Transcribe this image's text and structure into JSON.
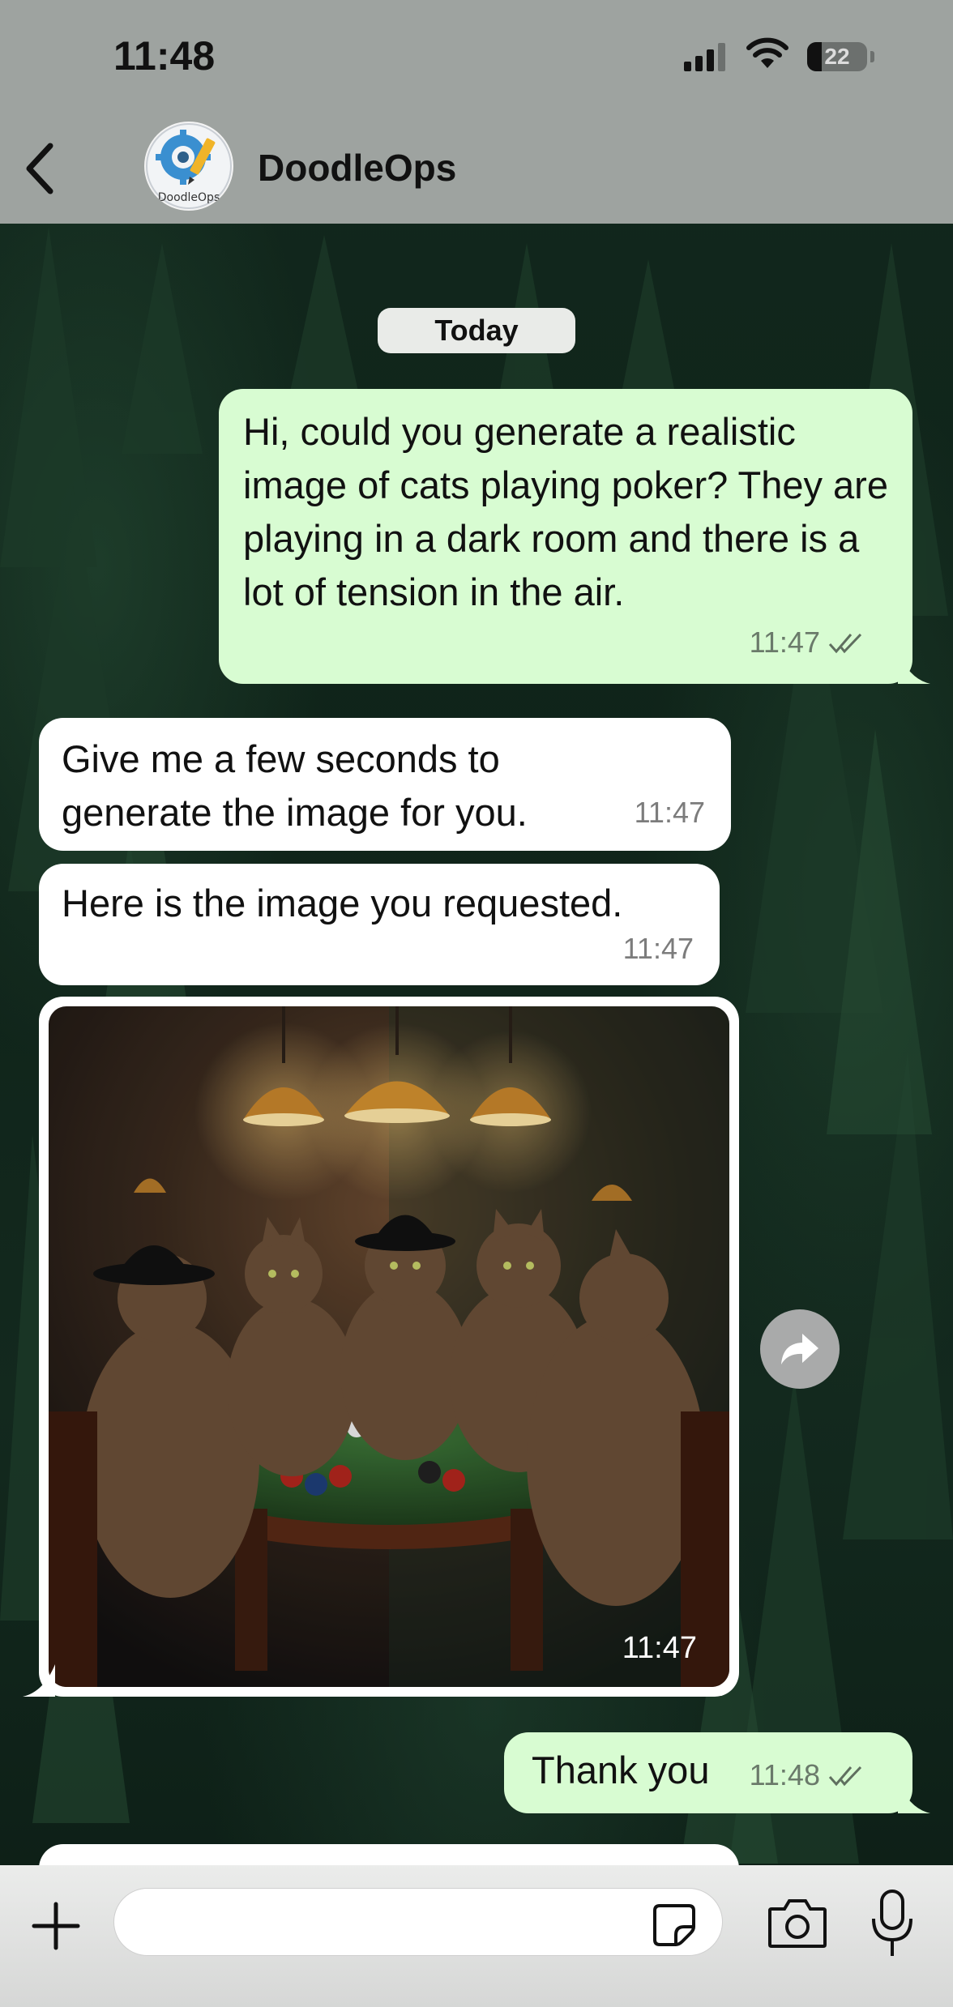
{
  "status_bar": {
    "time": "11:48",
    "battery": "22"
  },
  "header": {
    "contact_name": "DoodleOps",
    "avatar_icon": "doodleops-logo"
  },
  "chat": {
    "date_label": "Today",
    "messages": [
      {
        "direction": "outgoing",
        "text": "Hi, could you generate a realistic image of cats playing poker? They are playing in a dark room and there is a lot of tension in the air.",
        "time": "11:47",
        "status": "read-double-check"
      },
      {
        "direction": "incoming",
        "text": "Give me a few seconds to generate the image for you.",
        "time": "11:47"
      },
      {
        "direction": "incoming",
        "text": "Here is the image you requested.",
        "time": "11:47"
      },
      {
        "direction": "incoming",
        "type": "image",
        "image_description": "cats-playing-poker",
        "time": "11:47"
      },
      {
        "direction": "outgoing",
        "text": "Thank you",
        "time": "11:48",
        "status": "read-double-check"
      }
    ]
  },
  "input_bar": {
    "placeholder": ""
  },
  "colors": {
    "outgoing_bubble": "#d8fcd2",
    "incoming_bubble": "#ffffff",
    "header_bg": "#9ea3a0"
  }
}
